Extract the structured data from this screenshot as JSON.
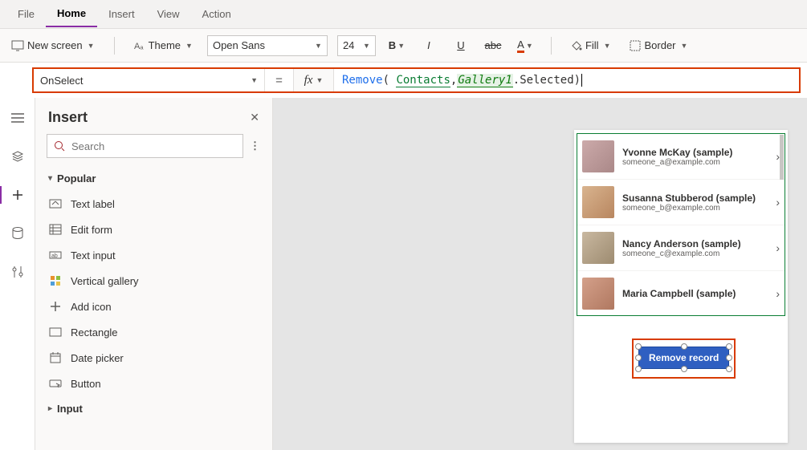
{
  "menu": {
    "file": "File",
    "home": "Home",
    "insert": "Insert",
    "view": "View",
    "action": "Action"
  },
  "ribbon": {
    "new_screen": "New screen",
    "theme": "Theme",
    "font_name": "Open Sans",
    "font_size": "24",
    "fill": "Fill",
    "border": "Border"
  },
  "formula": {
    "property": "OnSelect",
    "fn": "Remove",
    "open": "(",
    "ds": "Contacts",
    "comma": ", ",
    "ctrl": "Gallery1",
    "prop": ".Selected ",
    "close": ")"
  },
  "panel": {
    "title": "Insert",
    "search_placeholder": "Search",
    "cat_popular": "Popular",
    "items": {
      "text_label": "Text label",
      "edit_form": "Edit form",
      "text_input": "Text input",
      "vertical_gallery": "Vertical gallery",
      "add_icon": "Add icon",
      "rectangle": "Rectangle",
      "date_picker": "Date picker",
      "button": "Button"
    },
    "cat_input": "Input"
  },
  "gallery": {
    "rows": [
      {
        "name": "Yvonne McKay (sample)",
        "email": "someone_a@example.com"
      },
      {
        "name": "Susanna Stubberod (sample)",
        "email": "someone_b@example.com"
      },
      {
        "name": "Nancy Anderson (sample)",
        "email": "someone_c@example.com"
      },
      {
        "name": "Maria Campbell (sample)",
        "email": ""
      }
    ]
  },
  "button_label": "Remove record"
}
